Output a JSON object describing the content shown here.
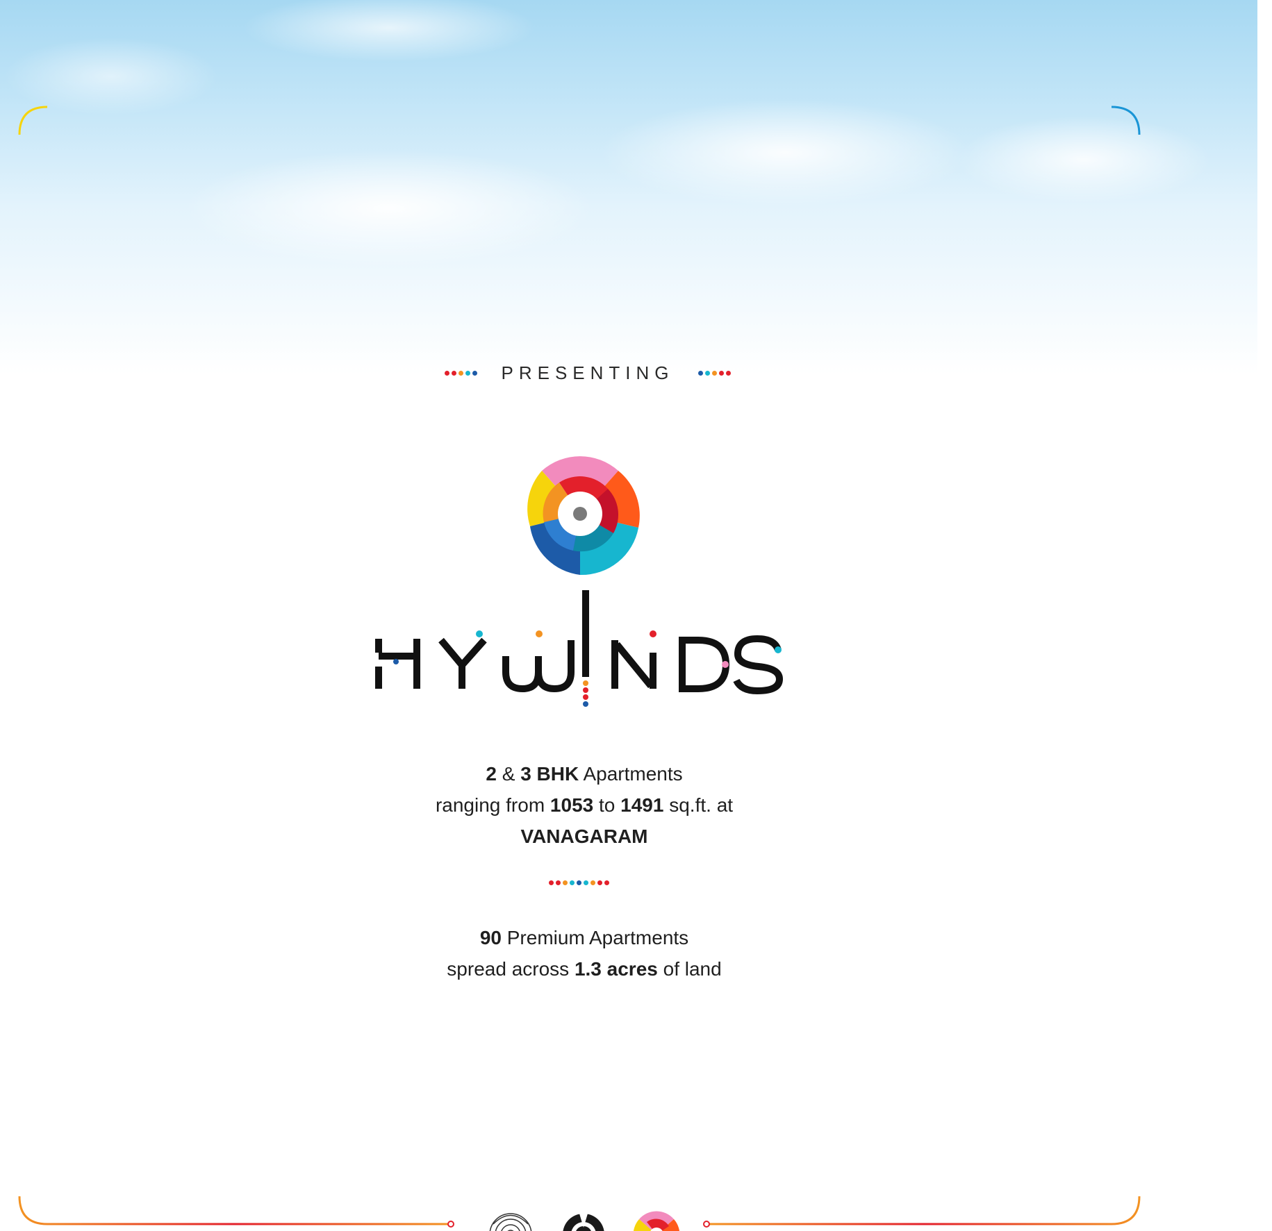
{
  "hero": {
    "presenting_label": "PRESENTING"
  },
  "brand": {
    "name": "HYWINDS"
  },
  "details": {
    "line1": {
      "num1": "2",
      "amp": "&",
      "num2": "3 BHK",
      "text": "Apartments"
    },
    "line2": {
      "prefix": "ranging from",
      "min": "1053",
      "to": "to",
      "max": "1491",
      "suffix": "sq.ft. at"
    },
    "line3": {
      "location": "VANAGARAM"
    }
  },
  "stats": {
    "line1": {
      "count": "90",
      "text": "Premium Apartments"
    },
    "line2": {
      "prefix": "spread across",
      "area": "1.3 acres",
      "suffix": "of land"
    }
  },
  "colors": {
    "red": "#e3202b",
    "orange": "#f39322",
    "yellow": "#f6d40c",
    "blue": "#1d5ba8",
    "cyan": "#17b6cf",
    "pink": "#f28bbd",
    "sky": "#a6d8f2"
  },
  "icons": [
    "pinwheel-outline-icon",
    "pinwheel-dark-icon",
    "pinwheel-color-icon"
  ]
}
